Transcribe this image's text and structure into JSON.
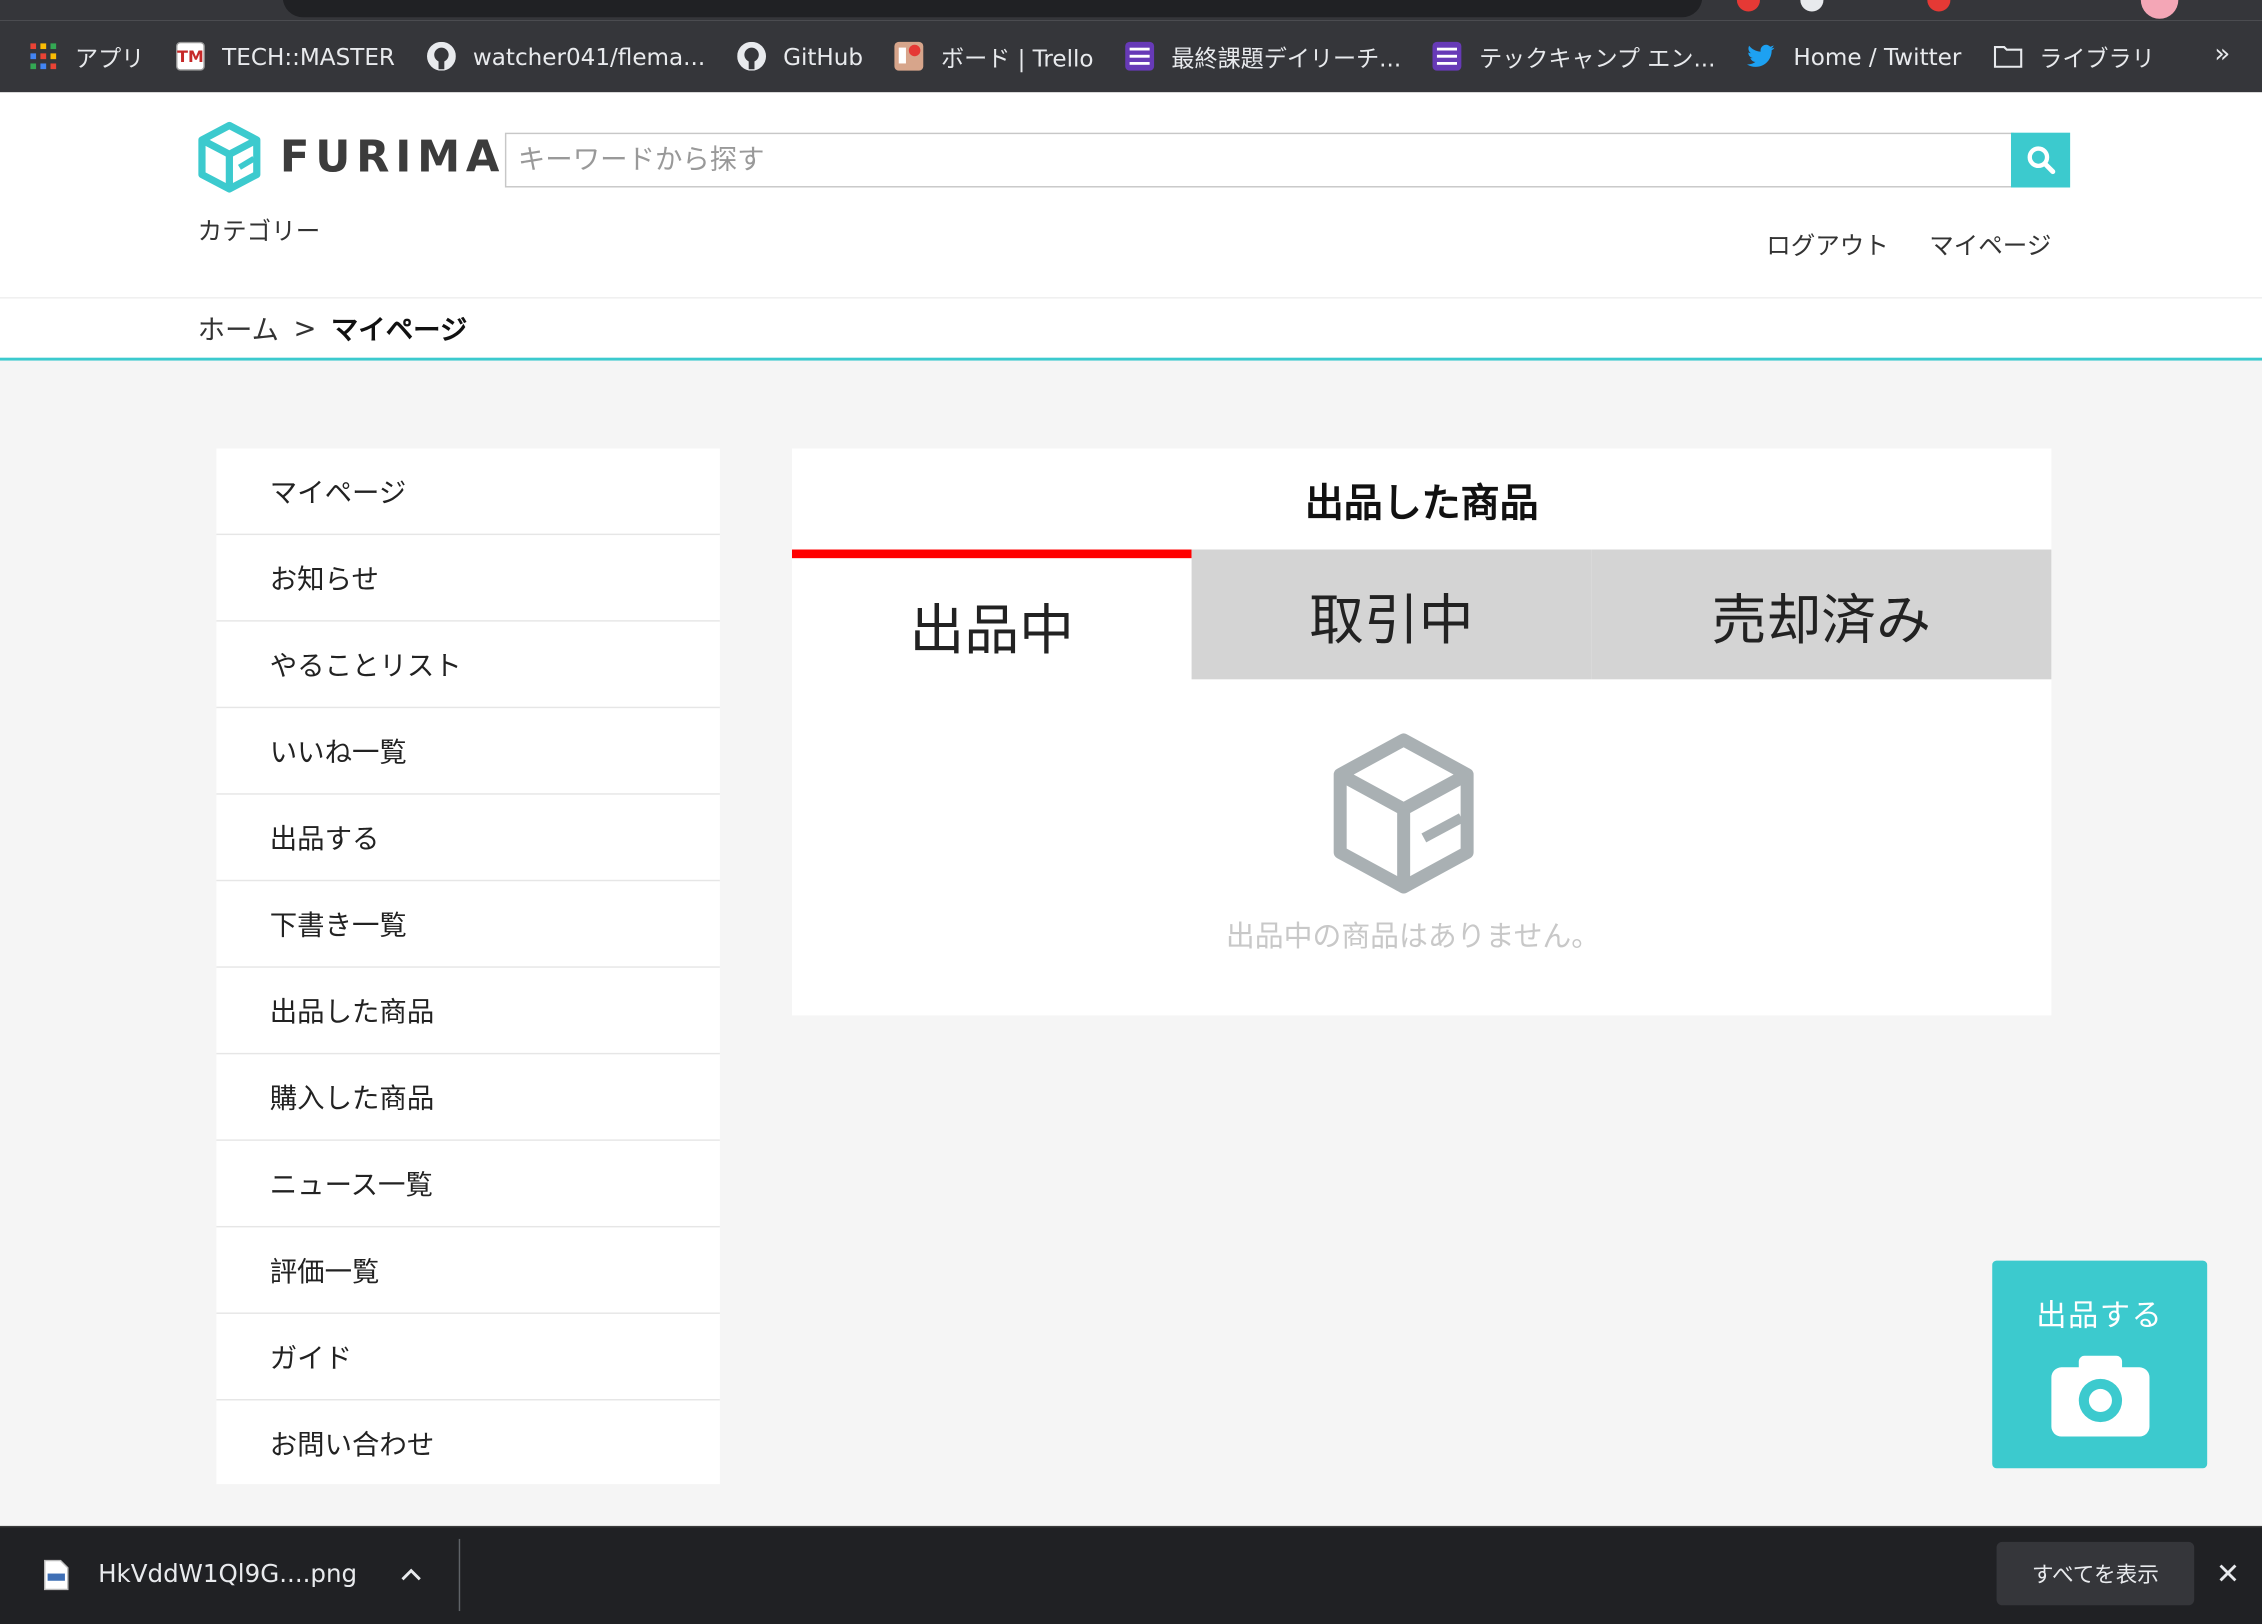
{
  "bookmarks": [
    {
      "label": "アプリ",
      "icon": "apps-grid-icon"
    },
    {
      "label": "TECH::MASTER",
      "icon": "tm-icon"
    },
    {
      "label": "watcher041/flema...",
      "icon": "github-icon"
    },
    {
      "label": "GitHub",
      "icon": "github-icon"
    },
    {
      "label": "ボード | Trello",
      "icon": "trello-icon"
    },
    {
      "label": "最終課題デイリーチ...",
      "icon": "list-icon"
    },
    {
      "label": "テックキャンプ エン...",
      "icon": "list-icon"
    },
    {
      "label": "Home / Twitter",
      "icon": "twitter-icon"
    },
    {
      "label": "ライブラリ",
      "icon": "folder-icon"
    }
  ],
  "bookmarks_more": "»",
  "header": {
    "logo_text": "FURIMA",
    "search_placeholder": "キーワードから探す",
    "category": "カテゴリー",
    "nav": {
      "logout": "ログアウト",
      "mypage": "マイページ"
    }
  },
  "breadcrumb": {
    "home": "ホーム",
    "separator": ">",
    "current": "マイページ"
  },
  "sidebar": {
    "items": [
      "マイページ",
      "お知らせ",
      "やることリスト",
      "いいね一覧",
      "出品する",
      "下書き一覧",
      "出品した商品",
      "購入した商品",
      "ニュース一覧",
      "評価一覧",
      "ガイド",
      "お問い合わせ"
    ]
  },
  "panel": {
    "title": "出品した商品",
    "tabs": [
      "出品中",
      "取引中",
      "売却済み"
    ],
    "active_tab": 0,
    "empty_message": "出品中の商品はありません。"
  },
  "sell_button": {
    "label": "出品する"
  },
  "download": {
    "filename": "HkVddW1Ql9G....png",
    "show_all": "すべてを表示",
    "close": "✕",
    "chevron": "^"
  },
  "colors": {
    "accent": "#3ccace",
    "active_tab_border": "#ff0000",
    "inactive_tab": "#d4d4d4"
  }
}
